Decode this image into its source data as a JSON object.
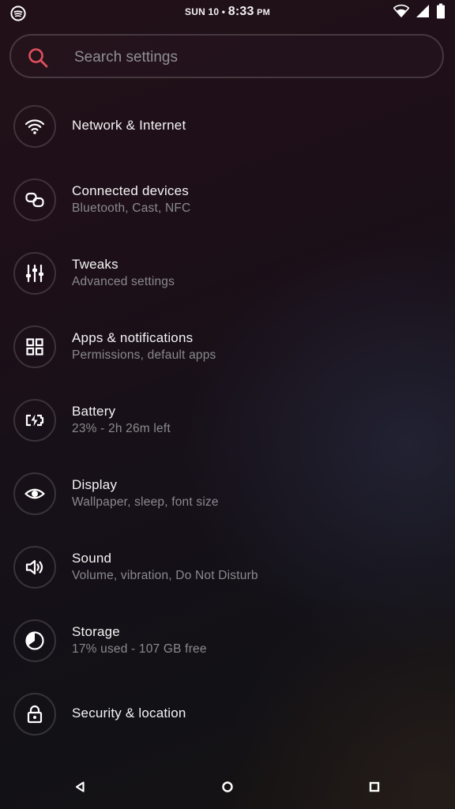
{
  "status_bar": {
    "date": "SUN 10",
    "separator": "•",
    "time": "8:33",
    "ampm": "PM",
    "left_icon": "spotify-icon",
    "right_icons": [
      "wifi-icon",
      "cellular-signal-icon",
      "battery-icon"
    ]
  },
  "search": {
    "placeholder": "Search settings",
    "value": "",
    "icon": "search-icon",
    "accent_color": "#e0505f"
  },
  "settings": [
    {
      "title": "Network & Internet",
      "subtitle": "",
      "icon": "wifi-icon"
    },
    {
      "title": "Connected devices",
      "subtitle": "Bluetooth, Cast, NFC",
      "icon": "connected-devices-icon"
    },
    {
      "title": "Tweaks",
      "subtitle": "Advanced settings",
      "icon": "sliders-icon"
    },
    {
      "title": "Apps & notifications",
      "subtitle": "Permissions, default apps",
      "icon": "apps-grid-icon"
    },
    {
      "title": "Battery",
      "subtitle": "23% - 2h 26m left",
      "icon": "battery-charging-icon"
    },
    {
      "title": "Display",
      "subtitle": "Wallpaper, sleep, font size",
      "icon": "eye-icon"
    },
    {
      "title": "Sound",
      "subtitle": "Volume, vibration, Do Not Disturb",
      "icon": "volume-icon"
    },
    {
      "title": "Storage",
      "subtitle": "17% used - 107 GB free",
      "icon": "storage-icon"
    },
    {
      "title": "Security & location",
      "subtitle": "",
      "icon": "lock-icon"
    }
  ],
  "nav": {
    "buttons": [
      "back-icon",
      "home-icon",
      "recents-icon"
    ]
  }
}
